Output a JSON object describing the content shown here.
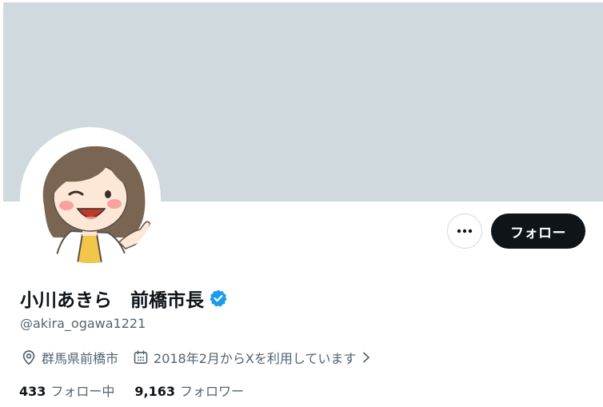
{
  "profile": {
    "display_name": "小川あきら　前橋市長",
    "handle": "@akira_ogawa1221",
    "verified": true,
    "location": "群馬県前橋市",
    "joined": "2018年2月からXを利用しています",
    "banner_color": "#cfd9de"
  },
  "actions": {
    "more_icon": "more-horizontal-icon",
    "follow_label": "フォロー"
  },
  "stats": {
    "following_count": "433",
    "following_label": "フォロー中",
    "followers_count": "9,163",
    "followers_label": "フォロワー"
  },
  "colors": {
    "text_primary": "#0f1419",
    "text_secondary": "#536471",
    "verified_blue": "#1d9bf0",
    "follow_button": "#0f1419"
  },
  "icons": {
    "location": "location-pin-icon",
    "calendar": "calendar-icon",
    "chevron": "chevron-right-icon",
    "verified": "verified-badge-icon"
  }
}
